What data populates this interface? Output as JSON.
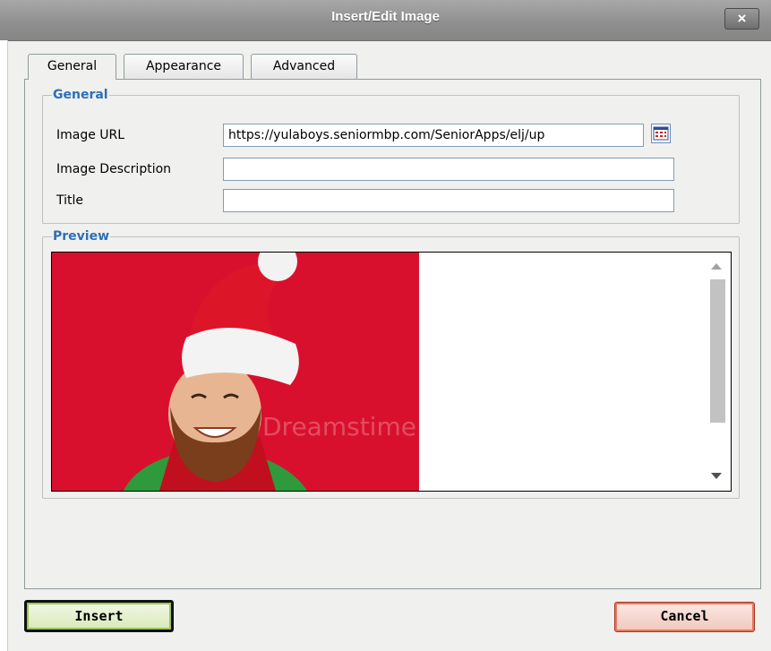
{
  "dialog": {
    "title": "Insert/Edit Image",
    "close_label": "×"
  },
  "tabs": [
    {
      "label": "General",
      "active": true
    },
    {
      "label": "Appearance",
      "active": false
    },
    {
      "label": "Advanced",
      "active": false
    }
  ],
  "general": {
    "legend": "General",
    "image_url_label": "Image URL",
    "image_url_value": "https://yulaboys.seniormbp.com/SeniorApps/elj/up",
    "image_description_label": "Image Description",
    "image_description_value": "",
    "title_label": "Title",
    "title_value": ""
  },
  "preview": {
    "legend": "Preview",
    "image_icon": "smiling-bearded-man-in-santa-hat-photo",
    "watermark": "Dreamstime"
  },
  "buttons": {
    "insert_label": "Insert",
    "cancel_label": "Cancel"
  },
  "colors": {
    "legend_blue": "#2b6fb6",
    "photo_background": "#d8102d",
    "insert_accent": "#9ec25a",
    "cancel_accent": "#e77a5e"
  }
}
